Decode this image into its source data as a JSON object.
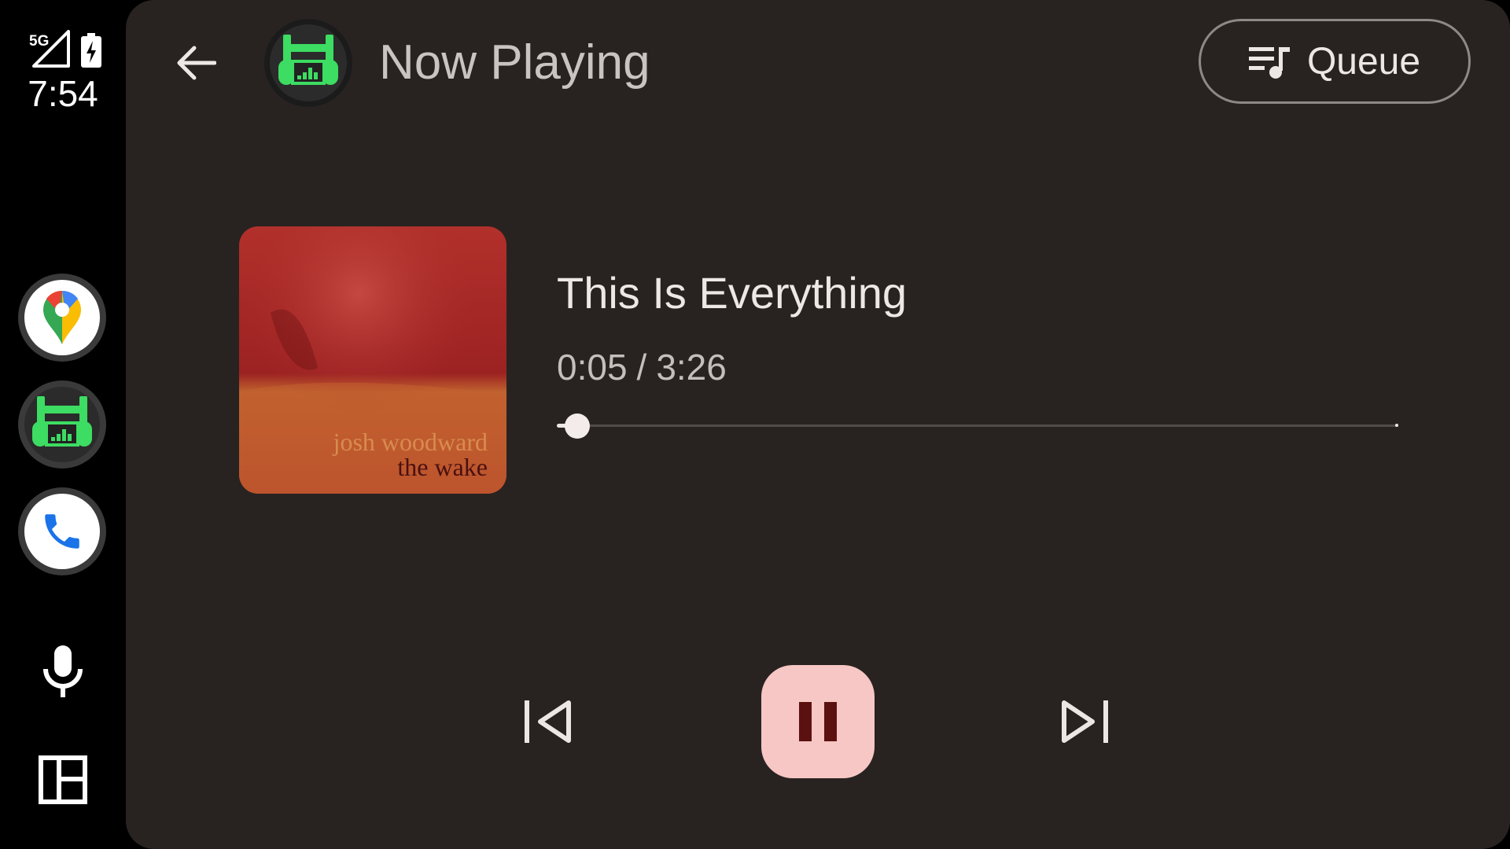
{
  "status_bar": {
    "network": "5G",
    "network_icon": "signal-icon",
    "battery_icon": "battery-charging-icon",
    "time": "7:54"
  },
  "rail": {
    "apps": [
      {
        "name": "maps",
        "icon": "maps-icon"
      },
      {
        "name": "media",
        "icon": "media-app-icon"
      },
      {
        "name": "phone",
        "icon": "phone-icon"
      }
    ],
    "tools": [
      {
        "name": "assistant",
        "icon": "microphone-icon"
      },
      {
        "name": "dashboard",
        "icon": "dashboard-icon"
      }
    ]
  },
  "header": {
    "back_icon": "back-arrow-icon",
    "title": "Now Playing",
    "queue_label": "Queue",
    "queue_icon": "queue-music-icon"
  },
  "album": {
    "artist_text": "josh woodward",
    "album_text": "the wake"
  },
  "track": {
    "title": "This Is Everything",
    "elapsed": "0:05",
    "separator": "/",
    "duration": "3:26",
    "progress_fraction": 0.024
  },
  "controls": {
    "previous_icon": "skip-previous-icon",
    "play_pause_icon": "pause-icon",
    "next_icon": "skip-next-icon"
  },
  "colors": {
    "panel": "#282321",
    "rail": "#000000",
    "accent_button": "#f6c7c4",
    "pause_glyph": "#5c1111",
    "brand_green": "#3ddc62"
  }
}
